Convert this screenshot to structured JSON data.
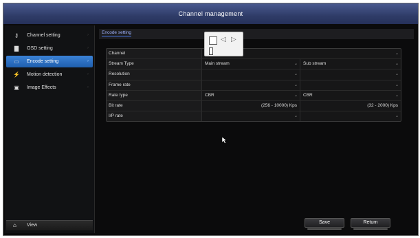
{
  "window": {
    "title": "Channel management"
  },
  "sidebar": {
    "items": [
      {
        "label": "Channel setting",
        "icon": "key-icon"
      },
      {
        "label": "OSD setting",
        "icon": "document-icon"
      },
      {
        "label": "Encode setting",
        "icon": "monitor-icon",
        "active": true
      },
      {
        "label": "Motion detection",
        "icon": "running-person-icon"
      },
      {
        "label": "Image Effects",
        "icon": "image-icon"
      }
    ],
    "view_label": "View"
  },
  "tab": {
    "label": "Encode setting"
  },
  "form": {
    "rows": [
      {
        "label": "Channel",
        "main": "",
        "sub": ""
      },
      {
        "label": "Stream Type",
        "main": "Main stream",
        "sub": "Sub stream"
      },
      {
        "label": "Resolution",
        "main": "",
        "sub": ""
      },
      {
        "label": "Frame rate",
        "main": "",
        "sub": ""
      },
      {
        "label": "Rate type",
        "main": "CBR",
        "sub": "CBR"
      },
      {
        "label": "Bit rate",
        "main": "(256 - 10000) Kps",
        "sub": "(32 - 2000) Kps"
      },
      {
        "label": "I/P rate",
        "main": "",
        "sub": ""
      }
    ]
  },
  "buttons": {
    "save": "Save",
    "return": "Return"
  },
  "colors": {
    "title_bar": "#2f3c68",
    "active_item": "#2f74c8",
    "tab_underline": "#4c7cf0"
  }
}
